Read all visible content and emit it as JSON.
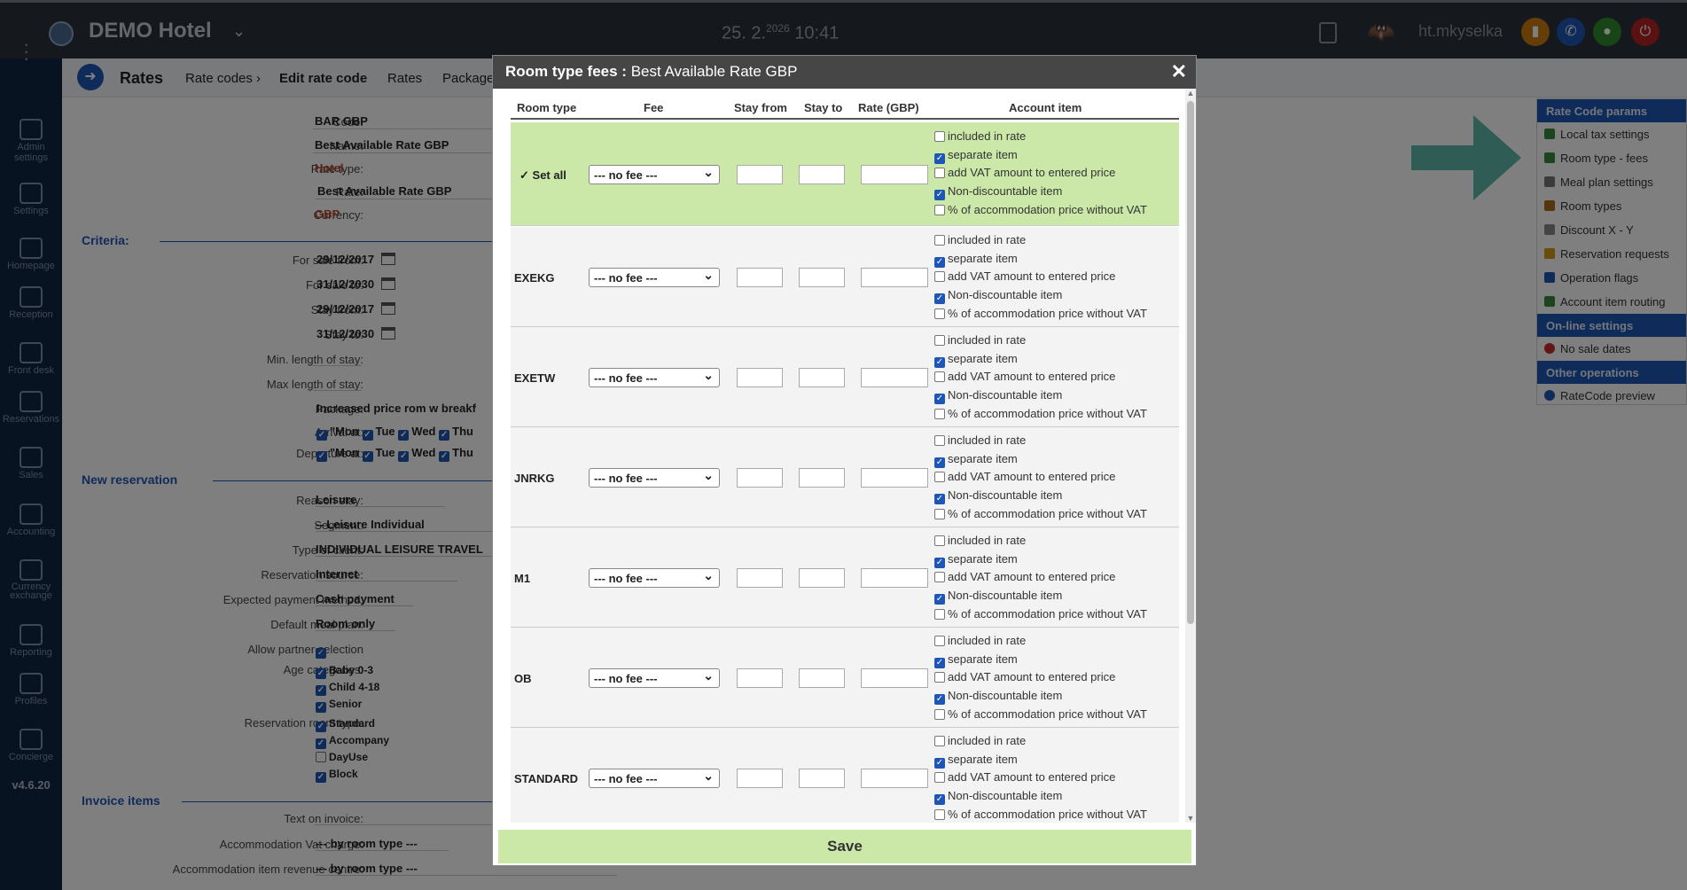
{
  "topbar": {
    "hotel_name": "DEMO Hotel",
    "date": "25. 2.",
    "year_sup": "2026",
    "time": "10:41",
    "username": "ht.mkyselka"
  },
  "sidebar": {
    "items": [
      "Admin settings",
      "Settings",
      "Homepage",
      "Reception",
      "Front desk",
      "Reservations",
      "Sales",
      "Accounting",
      "Currency exchange",
      "Reporting",
      "Profiles",
      "Concierge"
    ],
    "version": "v4.6.20"
  },
  "breadcrumb": {
    "title": "Rates",
    "items": [
      "Rate codes",
      "Edit rate code",
      "Rates",
      "Package"
    ]
  },
  "form": {
    "code_label": "Code:",
    "code": "BAR GBP",
    "name_label": "Name:",
    "name": "Best Available Rate GBP",
    "ratetype_label": "Rate type:",
    "ratetype": "Hotel",
    "rate_label": "Rate:",
    "rate": "Best Available Rate GBP",
    "currency_label": "Currency:",
    "currency": "GBP",
    "criteria": "Criteria:",
    "sale_from_label": "For sale from:",
    "sale_from": "29/12/2017",
    "sale_to_label": "For sale to:",
    "sale_to": "31/12/2030",
    "stay_from_label": "Stay from:",
    "stay_from": "29/12/2017",
    "stay_to_label": "Stay to:",
    "stay_to": "31/12/2030",
    "min_los_label": "Min. length of stay:",
    "max_los_label": "Max length of stay:",
    "package_label": "Package:",
    "package": "Increased price rom w breakf",
    "arrival_label": "Arrival at:",
    "departure_label": "Departure at:",
    "days": [
      "\"Mon",
      "Tue",
      "Wed",
      "Thu"
    ],
    "new_reservation": "New reservation",
    "reason_label": "Reason stay:",
    "reason": "Leisure",
    "segment_label": "Segment:",
    "segment": "-- Leisure Individual",
    "client_label": "Type of client:",
    "client": "INDIVIDUAL LEISURE TRAVEL",
    "source_label": "Reservation source:",
    "source": "Internet",
    "payment_label": "Expected payment method:",
    "payment": "Cash payment",
    "meal_label": "Default meal plan:",
    "meal": "Room only",
    "partner_label": "Allow partner selection",
    "age_label": "Age categories:",
    "ages": [
      "Baby 0-3",
      "Child 4-18",
      "Senior"
    ],
    "roomtype_label": "Reservation room type:",
    "roomtypes": [
      "Standard",
      "Accompany",
      "DayUse",
      "Block"
    ],
    "invoice_items": "Invoice items",
    "text_invoice_label": "Text on invoice:",
    "vat_label": "Accommodation Vat charge:",
    "vat": "--- by room type ---",
    "revenue_label": "Accommodation item revenue centre:",
    "revenue": "--- by room type ---"
  },
  "rpanel": {
    "params_header": "Rate Code params",
    "params": [
      "Local tax settings",
      "Room type - fees",
      "Meal plan settings",
      "Room types",
      "Discount X - Y",
      "Reservation requests",
      "Operation flags",
      "Account item routing"
    ],
    "online_header": "On-line settings",
    "online": [
      "No sale dates"
    ],
    "other_header": "Other operations",
    "other": [
      "RateCode preview"
    ]
  },
  "modal": {
    "title_bold": "Room type fees :",
    "title_rest": " Best Available Rate GBP",
    "headers": {
      "room_type": "Room type",
      "fee": "Fee",
      "stay_from": "Stay from",
      "stay_to": "Stay to",
      "rate": "Rate (GBP)",
      "account_item": "Account item"
    },
    "set_all": "Set all",
    "fee_option": "--- no fee ---",
    "account_items": [
      "included in rate",
      "separate item",
      "add VAT amount to entered price",
      "Non-discountable item",
      "% of accommodation price without VAT"
    ],
    "rows": [
      "EXEKG",
      "EXETW",
      "JNRKG",
      "M1",
      "OB",
      "STANDARD"
    ],
    "save": "Save"
  }
}
